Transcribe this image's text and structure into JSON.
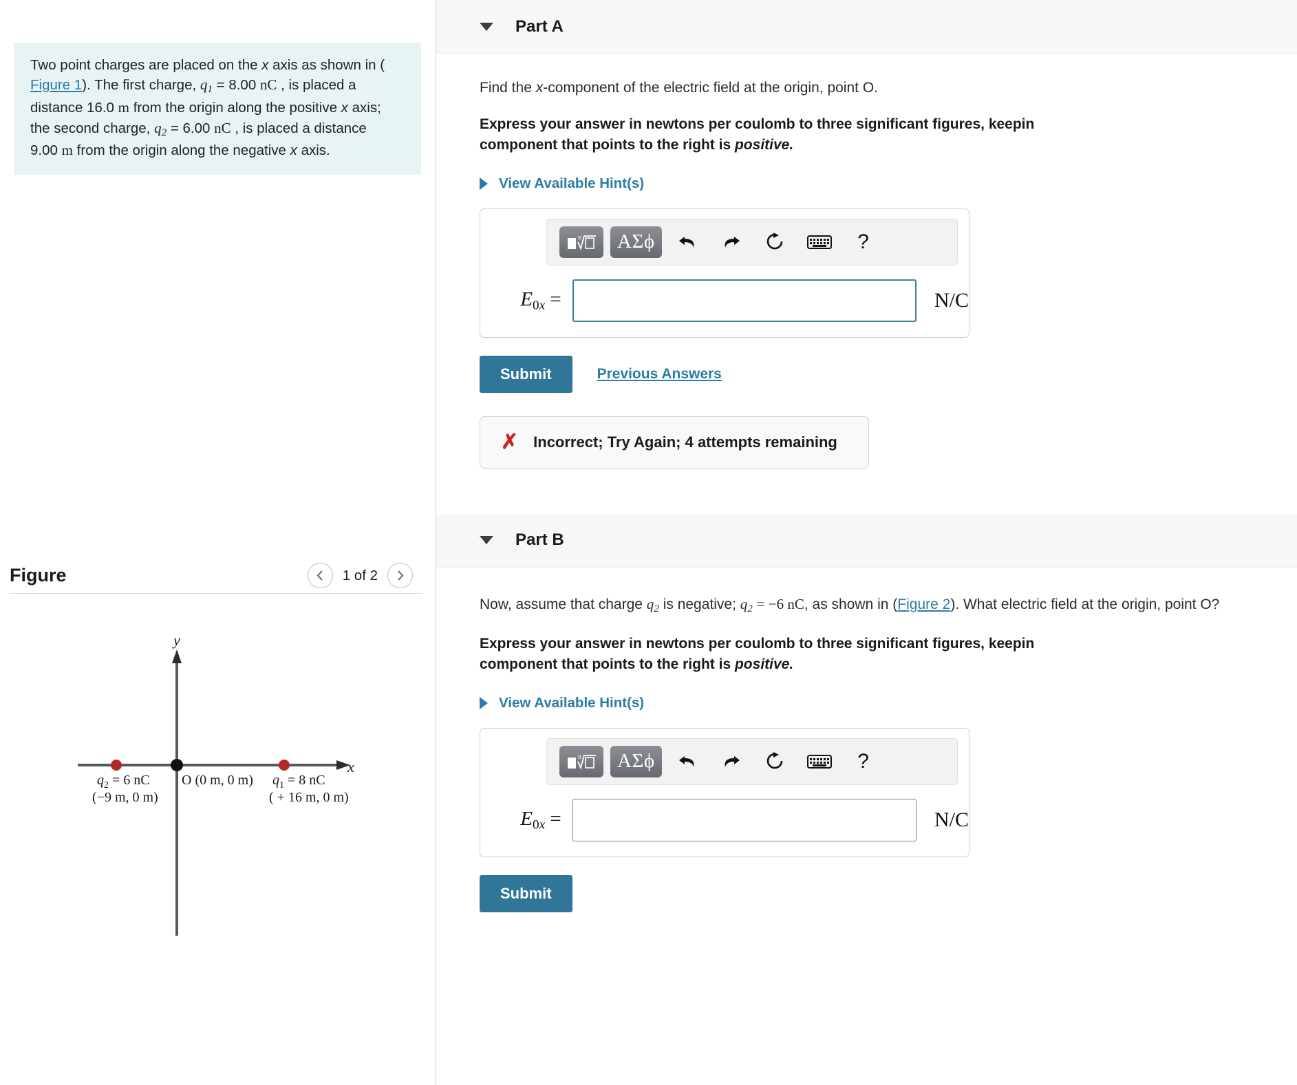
{
  "problem": {
    "lines": [
      "Two point charges are placed on the x axis as shown in (",
      "Figure 1). The first charge, q1 = 8.00 nC , is placed a",
      "distance 16.0 m from the origin along the positive x axis;",
      "the second charge, q2 = 6.00 nC , is placed a distance",
      "9.00 m from the origin along the negative x axis."
    ],
    "figure_link": "Figure 1"
  },
  "figure": {
    "title": "Figure",
    "counter": "1 of 2",
    "prev_icon": "chevron-left-icon",
    "next_icon": "chevron-right-icon",
    "axis_x_label": "x",
    "axis_y_label": "y",
    "origin_label": "O  (0 m, 0 m)",
    "charge_left_label": "q2 = 6 nC",
    "charge_left_coords": "( −9 m, 0 m)",
    "charge_right_label": "q1 = 8 nC",
    "charge_right_coords": "( + 16 m, 0 m)",
    "charge_color": "#b02a2a"
  },
  "part_a": {
    "title": "Part A",
    "question": "Find the x-component of the electric field at the origin, point O.",
    "instruction_lines": [
      "Express your answer in newtons per coulomb to three significant figures, keepin",
      "component that points to the right is positive."
    ],
    "hints_label": "View Available Hint(s)",
    "toolbar": {
      "template_button": "template-radical-icon",
      "greek_button": "ΑΣϕ",
      "undo_icon": "undo-arrow-icon",
      "redo_icon": "redo-arrow-icon",
      "reset_icon": "reset-circular-arrow-icon",
      "keyboard_icon": "keyboard-icon",
      "help_icon": "question-mark-icon"
    },
    "answer_label": "E",
    "answer_sub": "0",
    "answer_subx": "x",
    "answer_eq": "=",
    "answer_value": "",
    "answer_unit": "N/C",
    "submit_label": "Submit",
    "previous_answers_label": "Previous Answers",
    "feedback_icon": "x-mark-icon",
    "feedback_text": "Incorrect; Try Again; 4 attempts remaining"
  },
  "part_b": {
    "title": "Part B",
    "question_lines": [
      "Now, assume that charge q2 is negative; q2 = −6 nC, as shown in (Figure 2). What",
      "electric field at the origin, point O?"
    ],
    "figure_link": "Figure 2",
    "instruction_lines": [
      "Express your answer in newtons per coulomb to three significant figures, keepin",
      "component that points to the right is positive."
    ],
    "hints_label": "View Available Hint(s)",
    "toolbar": {
      "template_button": "template-radical-icon",
      "greek_button": "ΑΣϕ",
      "undo_icon": "undo-arrow-icon",
      "redo_icon": "redo-arrow-icon",
      "reset_icon": "reset-circular-arrow-icon",
      "keyboard_icon": "keyboard-icon",
      "help_icon": "question-mark-icon"
    },
    "answer_label": "E",
    "answer_sub": "0",
    "answer_subx": "x",
    "answer_eq": "=",
    "answer_value": "",
    "answer_unit": "N/C",
    "submit_label": "Submit"
  },
  "colors": {
    "accent": "#2b7ca5",
    "submit": "#2f7699",
    "problem_bg": "#e8f4f4",
    "error": "#cc2127"
  }
}
